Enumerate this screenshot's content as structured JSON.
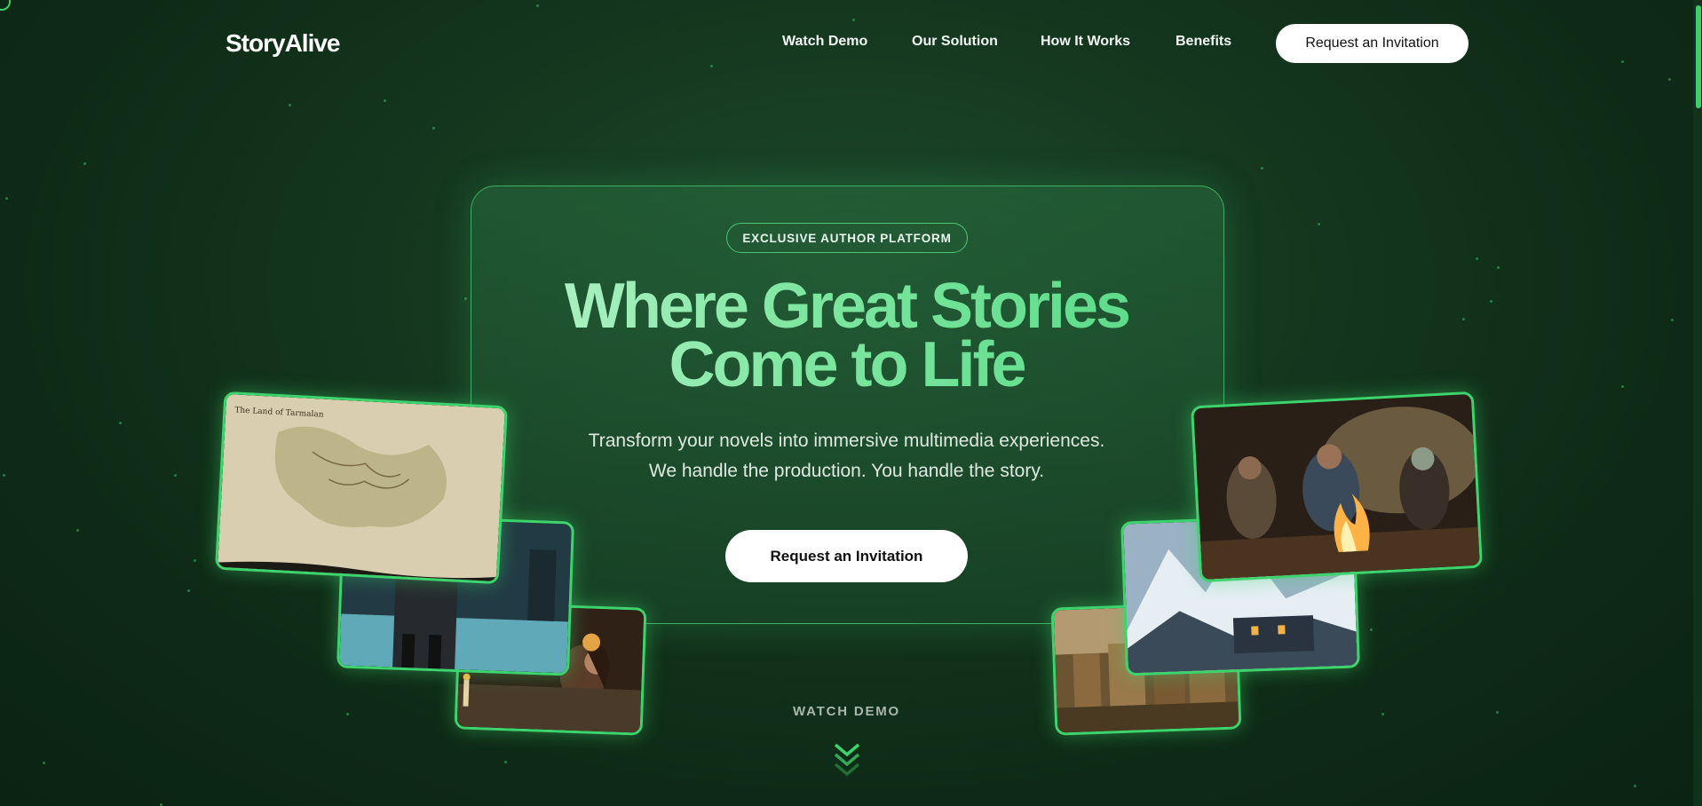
{
  "header": {
    "logo": "StoryAlive",
    "nav": [
      {
        "label": "Watch Demo"
      },
      {
        "label": "Our Solution"
      },
      {
        "label": "How It Works"
      },
      {
        "label": "Benefits"
      }
    ],
    "cta_label": "Request an Invitation"
  },
  "hero": {
    "badge": "EXCLUSIVE AUTHOR PLATFORM",
    "headline_line1": "Where Great Stories",
    "headline_line2": "Come to Life",
    "subtitle_line1": "Transform your novels into immersive multimedia experiences.",
    "subtitle_line2": "We handle the production. You handle the story.",
    "cta_label": "Request an Invitation"
  },
  "scroll_hint": {
    "label": "WATCH DEMO",
    "icon": "chevron-double-down-icon"
  },
  "gallery": {
    "map_caption": "The Land of Tarmalan"
  },
  "colors": {
    "background": "#0e2a16",
    "accent": "#3dd36d",
    "headline_gradient_start": "#b9f5cc",
    "headline_gradient_end": "#55d985",
    "button_bg": "#ffffff"
  }
}
